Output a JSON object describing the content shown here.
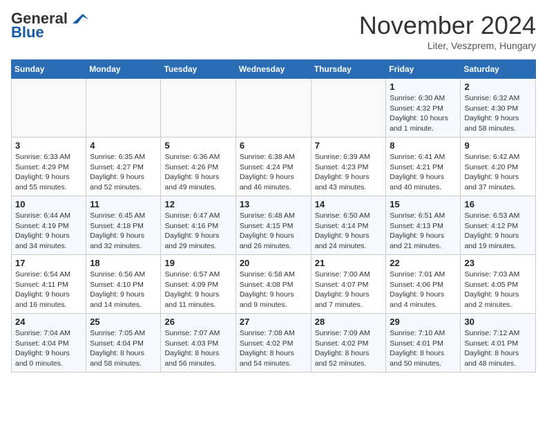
{
  "logo": {
    "line1": "General",
    "line2": "Blue"
  },
  "title": "November 2024",
  "subtitle": "Liter, Veszprem, Hungary",
  "days_header": [
    "Sunday",
    "Monday",
    "Tuesday",
    "Wednesday",
    "Thursday",
    "Friday",
    "Saturday"
  ],
  "weeks": [
    [
      {
        "day": "",
        "info": ""
      },
      {
        "day": "",
        "info": ""
      },
      {
        "day": "",
        "info": ""
      },
      {
        "day": "",
        "info": ""
      },
      {
        "day": "",
        "info": ""
      },
      {
        "day": "1",
        "info": "Sunrise: 6:30 AM\nSunset: 4:32 PM\nDaylight: 10 hours\nand 1 minute."
      },
      {
        "day": "2",
        "info": "Sunrise: 6:32 AM\nSunset: 4:30 PM\nDaylight: 9 hours\nand 58 minutes."
      }
    ],
    [
      {
        "day": "3",
        "info": "Sunrise: 6:33 AM\nSunset: 4:29 PM\nDaylight: 9 hours\nand 55 minutes."
      },
      {
        "day": "4",
        "info": "Sunrise: 6:35 AM\nSunset: 4:27 PM\nDaylight: 9 hours\nand 52 minutes."
      },
      {
        "day": "5",
        "info": "Sunrise: 6:36 AM\nSunset: 4:26 PM\nDaylight: 9 hours\nand 49 minutes."
      },
      {
        "day": "6",
        "info": "Sunrise: 6:38 AM\nSunset: 4:24 PM\nDaylight: 9 hours\nand 46 minutes."
      },
      {
        "day": "7",
        "info": "Sunrise: 6:39 AM\nSunset: 4:23 PM\nDaylight: 9 hours\nand 43 minutes."
      },
      {
        "day": "8",
        "info": "Sunrise: 6:41 AM\nSunset: 4:21 PM\nDaylight: 9 hours\nand 40 minutes."
      },
      {
        "day": "9",
        "info": "Sunrise: 6:42 AM\nSunset: 4:20 PM\nDaylight: 9 hours\nand 37 minutes."
      }
    ],
    [
      {
        "day": "10",
        "info": "Sunrise: 6:44 AM\nSunset: 4:19 PM\nDaylight: 9 hours\nand 34 minutes."
      },
      {
        "day": "11",
        "info": "Sunrise: 6:45 AM\nSunset: 4:18 PM\nDaylight: 9 hours\nand 32 minutes."
      },
      {
        "day": "12",
        "info": "Sunrise: 6:47 AM\nSunset: 4:16 PM\nDaylight: 9 hours\nand 29 minutes."
      },
      {
        "day": "13",
        "info": "Sunrise: 6:48 AM\nSunset: 4:15 PM\nDaylight: 9 hours\nand 26 minutes."
      },
      {
        "day": "14",
        "info": "Sunrise: 6:50 AM\nSunset: 4:14 PM\nDaylight: 9 hours\nand 24 minutes."
      },
      {
        "day": "15",
        "info": "Sunrise: 6:51 AM\nSunset: 4:13 PM\nDaylight: 9 hours\nand 21 minutes."
      },
      {
        "day": "16",
        "info": "Sunrise: 6:53 AM\nSunset: 4:12 PM\nDaylight: 9 hours\nand 19 minutes."
      }
    ],
    [
      {
        "day": "17",
        "info": "Sunrise: 6:54 AM\nSunset: 4:11 PM\nDaylight: 9 hours\nand 16 minutes."
      },
      {
        "day": "18",
        "info": "Sunrise: 6:56 AM\nSunset: 4:10 PM\nDaylight: 9 hours\nand 14 minutes."
      },
      {
        "day": "19",
        "info": "Sunrise: 6:57 AM\nSunset: 4:09 PM\nDaylight: 9 hours\nand 11 minutes."
      },
      {
        "day": "20",
        "info": "Sunrise: 6:58 AM\nSunset: 4:08 PM\nDaylight: 9 hours\nand 9 minutes."
      },
      {
        "day": "21",
        "info": "Sunrise: 7:00 AM\nSunset: 4:07 PM\nDaylight: 9 hours\nand 7 minutes."
      },
      {
        "day": "22",
        "info": "Sunrise: 7:01 AM\nSunset: 4:06 PM\nDaylight: 9 hours\nand 4 minutes."
      },
      {
        "day": "23",
        "info": "Sunrise: 7:03 AM\nSunset: 4:05 PM\nDaylight: 9 hours\nand 2 minutes."
      }
    ],
    [
      {
        "day": "24",
        "info": "Sunrise: 7:04 AM\nSunset: 4:04 PM\nDaylight: 9 hours\nand 0 minutes."
      },
      {
        "day": "25",
        "info": "Sunrise: 7:05 AM\nSunset: 4:04 PM\nDaylight: 8 hours\nand 58 minutes."
      },
      {
        "day": "26",
        "info": "Sunrise: 7:07 AM\nSunset: 4:03 PM\nDaylight: 8 hours\nand 56 minutes."
      },
      {
        "day": "27",
        "info": "Sunrise: 7:08 AM\nSunset: 4:02 PM\nDaylight: 8 hours\nand 54 minutes."
      },
      {
        "day": "28",
        "info": "Sunrise: 7:09 AM\nSunset: 4:02 PM\nDaylight: 8 hours\nand 52 minutes."
      },
      {
        "day": "29",
        "info": "Sunrise: 7:10 AM\nSunset: 4:01 PM\nDaylight: 8 hours\nand 50 minutes."
      },
      {
        "day": "30",
        "info": "Sunrise: 7:12 AM\nSunset: 4:01 PM\nDaylight: 8 hours\nand 48 minutes."
      }
    ]
  ]
}
